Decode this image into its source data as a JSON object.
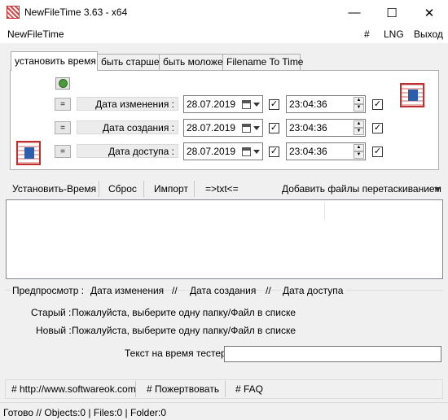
{
  "window": {
    "title": "NewFileTime 3.63 - x64",
    "minimize": "—",
    "maximize": "☐",
    "close": "✕"
  },
  "menu": {
    "app_name": "NewFileTime",
    "hash": "#",
    "lng": "LNG",
    "exit": "Выход"
  },
  "tabs": [
    {
      "label": "установить время",
      "active": true
    },
    {
      "label": "быть старше"
    },
    {
      "label": "быть моложе"
    },
    {
      "label": "Filename To Time"
    }
  ],
  "rows": [
    {
      "eq": "=",
      "label": "Дата изменения :",
      "date": "28.07.2019",
      "time": "23:04:36"
    },
    {
      "eq": "=",
      "label": "Дата создания :",
      "date": "28.07.2019",
      "time": "23:04:36"
    },
    {
      "eq": "=",
      "label": "Дата доступа :",
      "date": "28.07.2019",
      "time": "23:04:36"
    }
  ],
  "toolbar": {
    "set_time": "Установить-Время",
    "reset": "Сброс",
    "import": "Импорт",
    "txt": "=>txt<=",
    "drag_drop": "Добавить файлы перетаскиванием"
  },
  "preview": {
    "title": "Предпросмотр :",
    "mod": "Дата изменения",
    "sep1": "//",
    "created": "Дата создания",
    "sep2": "//",
    "accessed": "Дата доступа",
    "old_label": "Старый :",
    "old_value": "Пожалуйста, выберите одну папку/Файл в списке",
    "new_label": "Новый :",
    "new_value": "Пожалуйста, выберите одну папку/Файл в списке",
    "tester_label": "Текст на время тестер",
    "tester_value": ""
  },
  "links": {
    "website": "# http://www.softwareok.com",
    "donate": "# Пожертвовать",
    "faq": "# FAQ"
  },
  "status": "Готово // Objects:0 | Files:0 | Folder:0"
}
